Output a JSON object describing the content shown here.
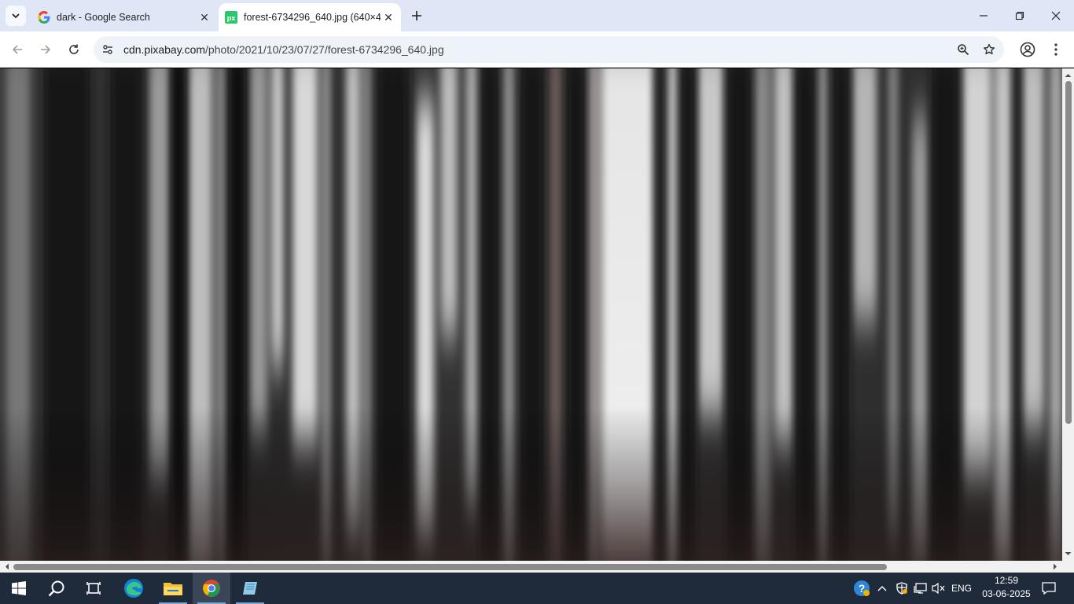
{
  "browser": {
    "tabs": [
      {
        "title": "dark - Google Search",
        "favicon": "google-g-icon",
        "active": false
      },
      {
        "title": "forest-6734296_640.jpg (640×4…",
        "favicon": "pixabay-px-icon",
        "active": true
      }
    ],
    "url": {
      "domain": "cdn.pixabay.com",
      "path": "/photo/2021/10/23/07/27/forest-6734296_640.jpg"
    }
  },
  "content": {
    "image_description": "blurred dark forest photo with vertical tree trunks",
    "image_name": "forest-6734296_640.jpg"
  },
  "taskbar": {
    "apps": [
      "start-icon",
      "search-icon",
      "task-view-icon",
      "edge-icon",
      "file-explorer-icon",
      "chrome-icon",
      "notepad-icon"
    ],
    "language": "ENG",
    "time": "12:59",
    "date": "03-06-2025"
  },
  "colors": {
    "tabstrip": "#dfe7f7",
    "omnibox": "#eef2f9",
    "taskbar": "#1f2a3a"
  }
}
